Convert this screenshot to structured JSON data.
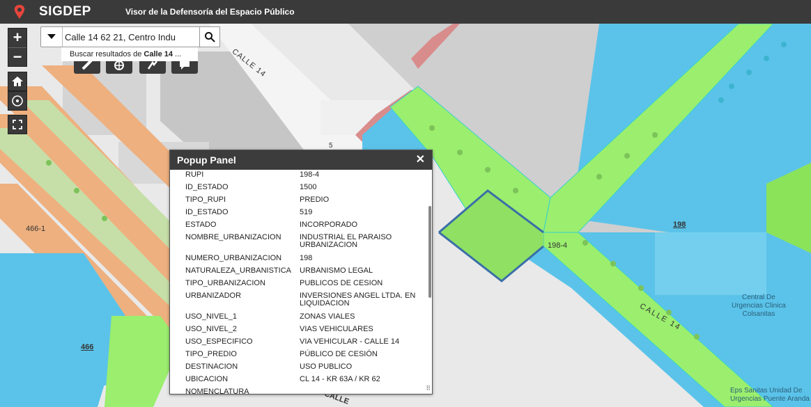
{
  "header": {
    "app_name": "SIGDEP",
    "subtitle": "Visor de la Defensoría del Espacio Público"
  },
  "search": {
    "value": "Calle 14 62 21, Centro Indu",
    "suggestion_prefix": "Buscar resultados de ",
    "suggestion_bold": "Calle 14",
    "suggestion_suffix": " ..."
  },
  "controls": {
    "zoom_in": "+",
    "zoom_out": "−"
  },
  "popup": {
    "title": "Popup Panel",
    "close": "✕",
    "fields": [
      {
        "key": "RUPI",
        "value": "198-4"
      },
      {
        "key": "ID_ESTADO",
        "value": "1500"
      },
      {
        "key": "TIPO_RUPI",
        "value": "PREDIO"
      },
      {
        "key": "ID_ESTADO",
        "value": "519"
      },
      {
        "key": "ESTADO",
        "value": "INCORPORADO"
      },
      {
        "key": "NOMBRE_URBANIZACION",
        "value": "INDUSTRIAL EL PARAISO URBANIZACION"
      },
      {
        "key": "NUMERO_URBANIZACION",
        "value": "198"
      },
      {
        "key": "NATURALEZA_URBANISTICA",
        "value": "URBANISMO LEGAL"
      },
      {
        "key": "TIPO_URBANIZACION",
        "value": "PUBLICOS DE CESION"
      },
      {
        "key": "URBANIZADOR",
        "value": "INVERSIONES ANGEL LTDA. EN LIQUIDACION"
      },
      {
        "key": "USO_NIVEL_1",
        "value": "ZONAS VIALES"
      },
      {
        "key": "USO_NIVEL_2",
        "value": "VIAS VEHICULARES"
      },
      {
        "key": "USO_ESPECIFICO",
        "value": "VIA VEHICULAR - CALLE 14"
      },
      {
        "key": "TIPO_PREDIO",
        "value": "PÚBLICO DE CESIÓN"
      },
      {
        "key": "DESTINACION",
        "value": "USO PUBLICO"
      },
      {
        "key": "UBICACION",
        "value": "CL 14 - KR 63A / KR 62"
      },
      {
        "key": "NOMENCLATURA",
        "value": ""
      }
    ]
  },
  "map_labels": {
    "street_top": "CALLE 14",
    "street_bottom": "CALLE 14",
    "street_popup_bottom": "CALLE",
    "parcel_198": "198",
    "parcel_198_4": "198-4",
    "parcel_466": "466",
    "parcel_466_1": "466-1",
    "poi_name": "Central De Urgencias Clinica Colsanitas",
    "poi_line1": "Central De",
    "poi_line2": "Urgencias Clinica",
    "poi_line3": "Colsanitas",
    "poi2_line1": "Eps Sanitas Unidad De",
    "poi2_line2": "Urgencias Puente Aranda",
    "small_label": "5"
  },
  "colors": {
    "header": "#3a3a3a",
    "green": "#9bee6e",
    "blue": "#5bc3e9",
    "orange": "#eda878",
    "gray_block": "#c9c9c9"
  }
}
